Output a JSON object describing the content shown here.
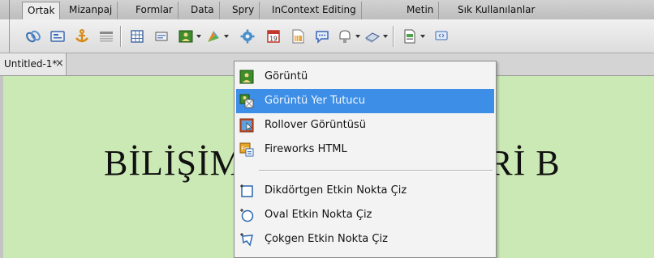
{
  "tabs": [
    {
      "label": "Ortak",
      "active": true
    },
    {
      "label": "Mizanpaj",
      "active": false
    },
    {
      "label": "Formlar",
      "active": false
    },
    {
      "label": "Data",
      "active": false
    },
    {
      "label": "Spry",
      "active": false
    },
    {
      "label": "InContext Editing",
      "active": false
    },
    {
      "label": "Metin",
      "active": false
    },
    {
      "label": "Sık Kullanılanlar",
      "active": false
    }
  ],
  "toolbar_icons": [
    "hyperlink-icon",
    "email-link-icon",
    "named-anchor-icon",
    "horizontal-rule-icon",
    "table-icon",
    "insert-div-icon",
    "image-icon",
    "media-icon",
    "widget-icon",
    "date-icon",
    "server-side-include-icon",
    "comment-icon",
    "head-icon",
    "script-icon",
    "templates-icon",
    "tag-chooser-icon"
  ],
  "document": {
    "tab_label": "Untitled-1*",
    "close_glyph": "×"
  },
  "canvas": {
    "heading_left": "BİLİŞİM",
    "heading_right": "JİLERİ B",
    "background": "#cbe9b4"
  },
  "menu": {
    "items": [
      {
        "label": "Görüntü",
        "icon": "image-icon",
        "highlighted": false
      },
      {
        "label": "Görüntü Yer Tutucu",
        "icon": "image-placeholder-icon",
        "highlighted": true
      },
      {
        "label": "Rollover Görüntüsü",
        "icon": "rollover-image-icon",
        "highlighted": false
      },
      {
        "label": "Fireworks HTML",
        "icon": "fireworks-html-icon",
        "highlighted": false
      },
      {
        "label": "Dikdörtgen Etkin Nokta Çiz",
        "icon": "rectangle-hotspot-icon",
        "highlighted": false
      },
      {
        "label": "Oval Etkin Nokta Çiz",
        "icon": "oval-hotspot-icon",
        "highlighted": false
      },
      {
        "label": "Çokgen Etkin Nokta Çiz",
        "icon": "polygon-hotspot-icon",
        "highlighted": false
      }
    ],
    "highlight_color": "#3d8ee6"
  }
}
